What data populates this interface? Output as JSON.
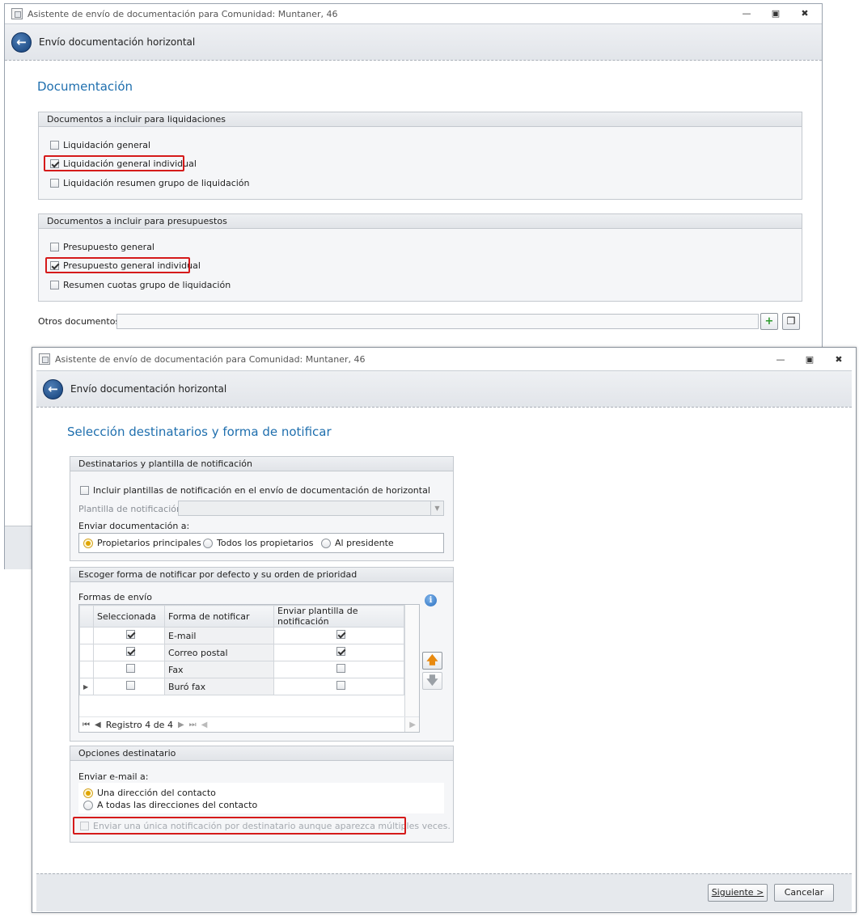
{
  "back_window": {
    "title": "Asistente de envío de documentación para Comunidad: Muntaner, 46",
    "header": "Envío documentación horizontal",
    "section_title": "Documentación",
    "group_liquidaciones": {
      "title": "Documentos a incluir para liquidaciones",
      "items": [
        {
          "label": "Liquidación general",
          "checked": false
        },
        {
          "label": "Liquidación general individual",
          "checked": true
        },
        {
          "label": "Liquidación resumen grupo de liquidación",
          "checked": false
        }
      ]
    },
    "group_presupuestos": {
      "title": "Documentos a incluir para presupuestos",
      "items": [
        {
          "label": "Presupuesto general",
          "checked": false
        },
        {
          "label": "Presupuesto general individual",
          "checked": true
        },
        {
          "label": "Resumen cuotas grupo de liquidación",
          "checked": false
        }
      ]
    },
    "otros_label": "Otros documentos:",
    "otros_value": ""
  },
  "front_window": {
    "title": "Asistente de envío de documentación para Comunidad: Muntaner, 46",
    "header": "Envío documentación horizontal",
    "section_title": "Selección destinatarios y forma de notificar",
    "group_destinatarios": {
      "title": "Destinatarios y plantilla de notificación",
      "incluir_label": "Incluir plantillas de notificación en el envío de documentación de horizontal",
      "plantilla_label": "Plantilla de notificación:",
      "plantilla_value": "",
      "enviar_label": "Enviar documentación a:",
      "radios": [
        "Propietarios principales",
        "Todos los propietarios",
        "Al presidente"
      ],
      "selected_radio": 0
    },
    "group_forma": {
      "title": "Escoger forma de notificar por defecto y su orden de prioridad",
      "formas_label": "Formas de envío",
      "columns": [
        "Seleccionada",
        "Forma de notificar",
        "Enviar plantilla de notificación"
      ],
      "rows": [
        {
          "selected": true,
          "forma": "E-mail",
          "plantilla": true
        },
        {
          "selected": true,
          "forma": "Correo postal",
          "plantilla": true
        },
        {
          "selected": false,
          "forma": "Fax",
          "plantilla": false
        },
        {
          "selected": false,
          "forma": "Buró fax",
          "plantilla": false
        }
      ],
      "navigator_text": "Registro 4 de 4"
    },
    "group_opciones": {
      "title": "Opciones destinatario",
      "enviar_email_label": "Enviar e-mail a:",
      "radios": [
        "Una dirección del contacto",
        "A todas las direcciones del contacto"
      ],
      "selected_radio": 0,
      "unica_label": "Enviar una única notificación por destinatario aunque aparezca múltiples veces."
    },
    "buttons": {
      "next": "Siguiente >",
      "cancel": "Cancelar"
    }
  },
  "colors": {
    "accent": "#1f6fae",
    "highlight_border": "#d51a1a",
    "radio_selected": "#e0a500"
  }
}
